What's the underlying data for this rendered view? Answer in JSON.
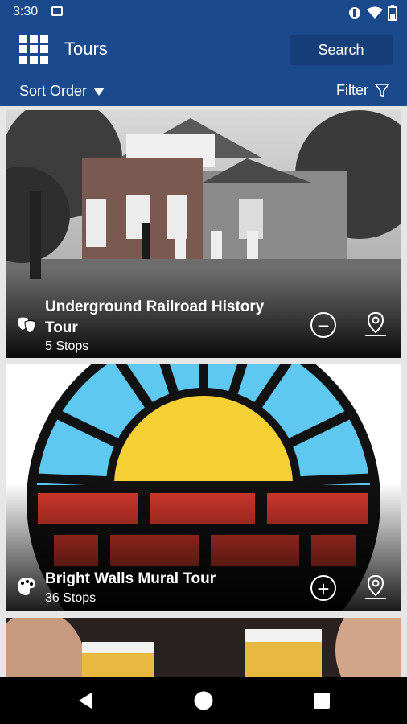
{
  "status": {
    "time": "3:30"
  },
  "appbar": {
    "title": "Tours",
    "search_label": "Search"
  },
  "subbar": {
    "sort_label": "Sort Order",
    "filter_label": "Filter"
  },
  "tours": [
    {
      "title": "Underground Railroad History Tour",
      "stops": "5 Stops",
      "category_icon": "theater-masks-icon",
      "action_icon": "minus-circle-icon"
    },
    {
      "title": "Bright Walls Mural Tour",
      "stops": "36 Stops",
      "category_icon": "palette-icon",
      "action_icon": "plus-circle-icon"
    }
  ],
  "colors": {
    "primary": "#1b4a8c",
    "primary_dark": "#163e78",
    "sun": "#f5d034",
    "sky": "#5ec8f0",
    "brick": "#d83a2e"
  }
}
